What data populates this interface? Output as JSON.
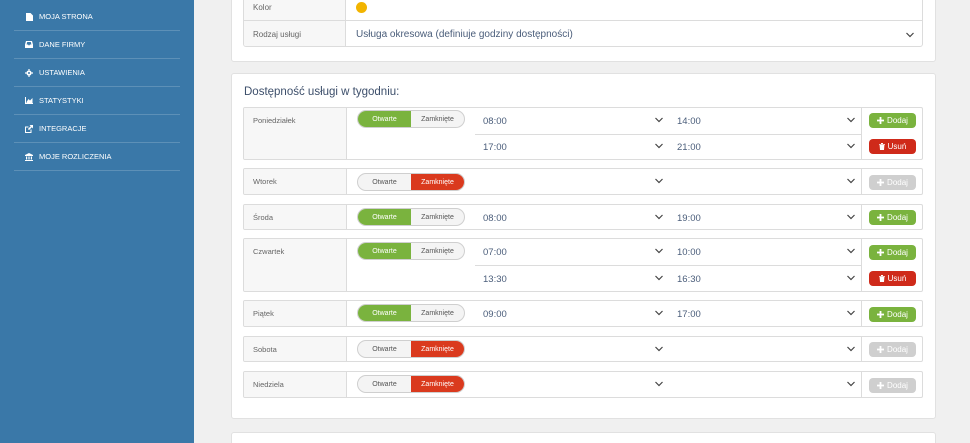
{
  "sidebar": {
    "items": [
      {
        "label": "MOJA STRONA",
        "icon": "file-icon"
      },
      {
        "label": "DANE FIRMY",
        "icon": "inbox-icon"
      },
      {
        "label": "USTAWIENIA",
        "icon": "gear-icon"
      },
      {
        "label": "STATYSTYKI",
        "icon": "chart-icon"
      },
      {
        "label": "INTEGRACJE",
        "icon": "external-link-icon"
      },
      {
        "label": "MOJE ROZLICZENIA",
        "icon": "bank-icon"
      }
    ]
  },
  "service_form": {
    "color_label": "Kolor",
    "color_value": "#f2b400",
    "type_label": "Rodzaj usługi",
    "type_value": "Usługa okresowa (definiuje godziny dostępności)"
  },
  "availability": {
    "title": "Dostępność usługi w tygodniu:",
    "open_label": "Otwarte",
    "closed_label": "Zamknięte",
    "add_label": "Dodaj",
    "remove_label": "Usuń",
    "days": [
      {
        "name": "Poniedziałek",
        "state": "open",
        "slots": [
          {
            "from": "08:00",
            "to": "14:00"
          },
          {
            "from": "17:00",
            "to": "21:00"
          }
        ]
      },
      {
        "name": "Wtorek",
        "state": "closed",
        "slots": [
          {
            "from": "",
            "to": ""
          }
        ]
      },
      {
        "name": "Środa",
        "state": "open",
        "slots": [
          {
            "from": "08:00",
            "to": "19:00"
          }
        ]
      },
      {
        "name": "Czwartek",
        "state": "open",
        "slots": [
          {
            "from": "07:00",
            "to": "10:00"
          },
          {
            "from": "13:30",
            "to": "16:30"
          }
        ]
      },
      {
        "name": "Piątek",
        "state": "open",
        "slots": [
          {
            "from": "09:00",
            "to": "17:00"
          }
        ]
      },
      {
        "name": "Sobota",
        "state": "closed",
        "slots": [
          {
            "from": "",
            "to": ""
          }
        ]
      },
      {
        "name": "Niedziela",
        "state": "closed",
        "slots": [
          {
            "from": "",
            "to": ""
          }
        ]
      }
    ]
  },
  "colors": {
    "sidebar": "#3a78a8",
    "open_active": "#7ab33e",
    "closed_active": "#da3a1e",
    "remove": "#cf2a1a",
    "add_disabled": "#cfcfcf"
  }
}
